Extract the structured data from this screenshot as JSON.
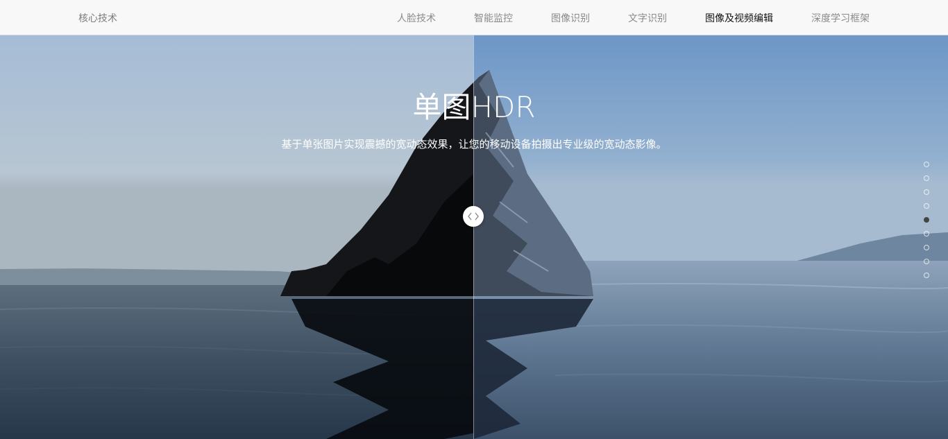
{
  "header": {
    "brand": "核心技术",
    "nav": [
      {
        "label": "人脸技术",
        "active": false
      },
      {
        "label": "智能监控",
        "active": false
      },
      {
        "label": "图像识别",
        "active": false
      },
      {
        "label": "文字识别",
        "active": false
      },
      {
        "label": "图像及视频编辑",
        "active": true
      },
      {
        "label": "深度学习框架",
        "active": false
      }
    ]
  },
  "hero": {
    "title": "单图HDR",
    "subtitle": "基于单张图片实现震撼的宽动态效果，让您的移动设备拍摄出专业级的宽动态影像。",
    "compare_handle_icon": "chevron-left-right-icon"
  },
  "pager": {
    "count": 9,
    "active_index": 4
  },
  "colors": {
    "header_bg": "#f8f8f8",
    "nav_active": "#111111",
    "nav_inactive": "#8a8a8a",
    "dot_active": "#444444"
  }
}
